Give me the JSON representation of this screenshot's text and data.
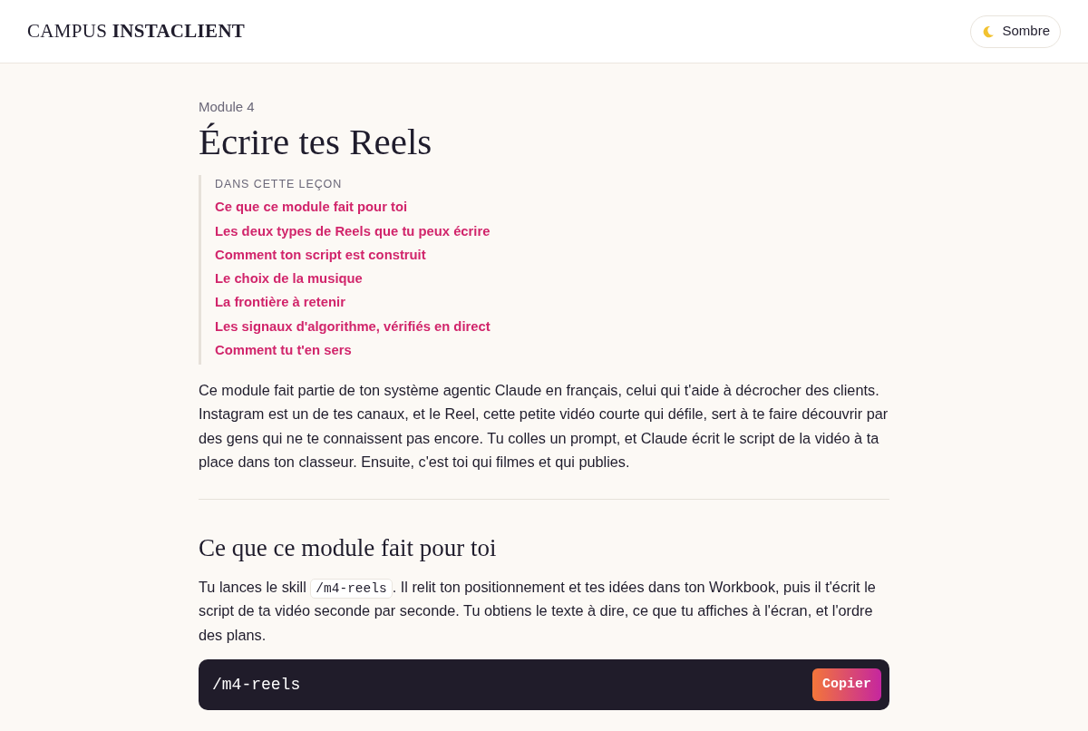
{
  "header": {
    "logo": "CAMPUS **INSTACLIENT**",
    "theme_button": {
      "label": "Sombre"
    }
  },
  "lesson": {
    "module_label": "Module 4",
    "title": "Écrire tes Reels",
    "toc": {
      "heading": "DANS CETTE LEÇON",
      "items": [
        "Ce que ce module fait pour toi",
        "Les deux types de Reels que tu peux écrire",
        "Comment ton script est construit",
        "Le choix de la musique",
        "La frontière à retenir",
        "Les signaux d'algorithme, vérifiés en direct",
        "Comment tu t'en sers"
      ]
    },
    "intro": "Ce module fait partie de ton système agentic Claude en français, celui qui t'aide à décrocher des clients. Instagram est un de tes canaux, et le Reel, cette petite vidéo courte qui défile, sert à te faire découvrir par des gens qui ne te connaissent pas encore. Tu colles un prompt, et Claude écrit le script de la vidéo à ta place dans ton classeur. Ensuite, c'est toi qui filmes et qui publies.",
    "sections": [
      {
        "heading": "Ce que ce module fait pour toi",
        "paragraph": [
          {
            "kind": "text",
            "text": "Tu lances le skill "
          },
          {
            "kind": "code",
            "text": "/m4-reels"
          },
          {
            "kind": "text",
            "text": ". Il relit ton positionnement et tes idées dans ton Workbook, puis il t'écrit le script de ta vidéo seconde par seconde. Tu obtiens le texte à dire, ce que tu affiches à l'écran, et l'ordre des plans."
          }
        ],
        "code_block": {
          "command": "/m4-reels",
          "copy_button": "Copier"
        }
      }
    ]
  }
}
